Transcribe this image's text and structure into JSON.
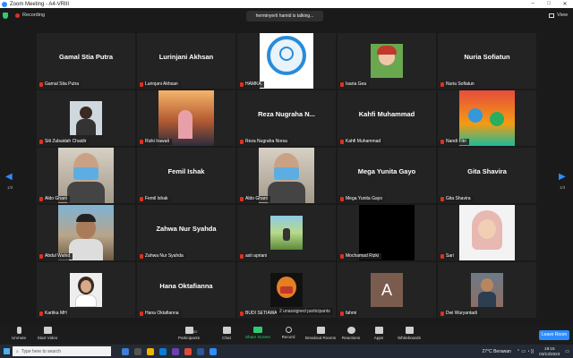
{
  "window": {
    "title": "Zoom Meeting - A4-VRIII"
  },
  "meeting_bar": {
    "recording_label": "Recording",
    "view_label": "View"
  },
  "toast": {
    "text": "herminyerti hamid is talking..."
  },
  "pagination": {
    "left": "1/3",
    "right": "1/3"
  },
  "tiles": [
    {
      "row": 0,
      "col": 0,
      "big": "Gamal Stia Putra",
      "label": "Gamal Stia Putra",
      "media": "none"
    },
    {
      "row": 0,
      "col": 1,
      "big": "Lurinjani Akhsan",
      "label": "Lurinjani Akhsan",
      "media": "none"
    },
    {
      "row": 0,
      "col": 2,
      "big": "",
      "label": "HAMKA",
      "media": "logo"
    },
    {
      "row": 0,
      "col": 3,
      "big": "",
      "label": "Isaria Gea",
      "media": "cartoon"
    },
    {
      "row": 0,
      "col": 4,
      "big": "Nuria Sofiatun",
      "label": "Nuria Sofiatun",
      "media": "none"
    },
    {
      "row": 1,
      "col": 0,
      "big": "",
      "label": "Siti Zubaidah Chaidir",
      "media": "person"
    },
    {
      "row": 1,
      "col": 1,
      "big": "",
      "label": "Rizki Irawati",
      "media": "sunset"
    },
    {
      "row": 1,
      "col": 2,
      "big": "Reza Nugraha N...",
      "label": "Reza Nugraha Norsa",
      "media": "none"
    },
    {
      "row": 1,
      "col": 3,
      "big": "Kahfi Muhammad",
      "label": "Kahfi Muhammad",
      "media": "none"
    },
    {
      "row": 1,
      "col": 4,
      "big": "",
      "label": "Nandi Fitri",
      "media": "poster"
    },
    {
      "row": 2,
      "col": 0,
      "big": "",
      "label": "Aldo Ghani",
      "media": "masked"
    },
    {
      "row": 2,
      "col": 1,
      "big": "Femil Ishak",
      "label": "Femil Ishak",
      "media": "none"
    },
    {
      "row": 2,
      "col": 2,
      "big": "",
      "label": "Aldo Ghani",
      "media": "masked"
    },
    {
      "row": 2,
      "col": 3,
      "big": "Mega Yunita Gayo",
      "label": "Mega Yunita Gayo",
      "media": "none"
    },
    {
      "row": 2,
      "col": 4,
      "big": "Gita Shavira",
      "label": "Gita Shavira",
      "media": "none"
    },
    {
      "row": 3,
      "col": 0,
      "big": "",
      "label": "Abdul Wahid",
      "media": "outdoor"
    },
    {
      "row": 3,
      "col": 1,
      "big": "Zahwa Nur Syahda",
      "label": "Zahwa Nur Syahda",
      "media": "none"
    },
    {
      "row": 3,
      "col": 2,
      "big": "",
      "label": "asti apriani",
      "media": "landscape"
    },
    {
      "row": 3,
      "col": 3,
      "big": "",
      "label": "Mochamad Rizki",
      "media": "black"
    },
    {
      "row": 3,
      "col": 4,
      "big": "",
      "label": "Sari",
      "media": "hijab"
    },
    {
      "row": 4,
      "col": 0,
      "big": "",
      "label": "Kartika MH",
      "media": "portrait"
    },
    {
      "row": 4,
      "col": 1,
      "big": "Hana Oktafianna",
      "label": "Hana Oktafianna",
      "media": "none"
    },
    {
      "row": 4,
      "col": 2,
      "big": "",
      "label": "BUDI SETIAWAN",
      "media": "mask-red"
    },
    {
      "row": 4,
      "col": 3,
      "big": "",
      "label": "fahmi",
      "media": "avatar",
      "avatar_letter": "A"
    },
    {
      "row": 4,
      "col": 4,
      "big": "",
      "label": "Dwi Wuryantadi",
      "media": "outdoor2"
    }
  ],
  "unassigned": "2 unassigned participants",
  "toolbar": {
    "unmute": "Unmute",
    "start_video": "Start Video",
    "participants": "Participants",
    "participants_count": "52",
    "chat": "Chat",
    "share_screen": "Share Screen",
    "record": "Record",
    "breakout_rooms": "Breakout Rooms",
    "reactions": "Reactions",
    "apps": "Apps",
    "whiteboards": "Whiteboards",
    "leave": "Leave Room"
  },
  "taskbar": {
    "search_placeholder": "Type here to search",
    "weather": "27°C  Berawan",
    "time": "19:15",
    "date": "03/13/2023"
  },
  "colors": {
    "accent": "#2d8cff",
    "muted": "#e0301e",
    "share": "#2ecc71"
  }
}
